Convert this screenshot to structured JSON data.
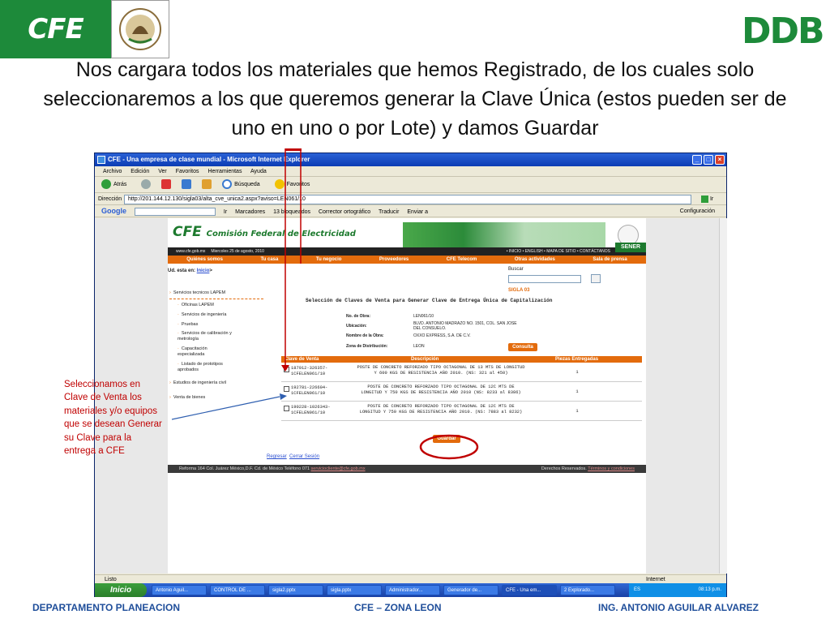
{
  "slide": {
    "title": "Nos cargara todos los materiales que hemos Registrado, de los cuales solo seleccionaremos a los que queremos generar la Clave Única (estos pueden ser de uno en uno o por Lote) y damos Guardar",
    "cfe_logo": "CFE",
    "ddb_logo": "DDB",
    "annotation": "Seleccionamos en Clave de Venta los materiales y/o equipos que se desean Generar su Clave para la entrega a CFE",
    "footer": {
      "left": "DEPARTAMENTO PLANEACION",
      "center": "CFE – ZONA LEON",
      "right": "ING. ANTONIO AGUILAR ALVAREZ"
    },
    "colors": {
      "accent_green": "#1d8a3a",
      "annotation_red": "#c00000",
      "footer_blue": "#1f4e9a"
    }
  },
  "browser": {
    "window_title": "CFE - Una empresa de clase mundial - Microsoft Internet Explorer",
    "menu": [
      "Archivo",
      "Edición",
      "Ver",
      "Favoritos",
      "Herramientas",
      "Ayuda"
    ],
    "toolbar": {
      "back": "Atrás",
      "search": "Búsqueda",
      "favorites": "Favoritos"
    },
    "address_label": "Dirección",
    "address": "http://201.144.12.130/sigla03/alta_cve_unica2.aspx?aviso=LEN061/10",
    "go": "Ir",
    "google": {
      "logo": "Google",
      "search_placeholder": "G",
      "go": "Ir",
      "bookmarks": "Marcadores",
      "blocked": "13 bloqueados",
      "spell": "Corrector ortográfico",
      "translate": "Traducir",
      "send": "Enviar a",
      "settings": "Configuración"
    },
    "status": "Listo",
    "zone": "Internet"
  },
  "taskbar": {
    "start": "Inicio",
    "tasks": [
      "Antonio Aguil...",
      "CONTROL DE ...",
      "sigla2.pptx",
      "sigla.pptx",
      "Administrador...",
      "Generador de...",
      "CFE - Una em...",
      "2 Explorado..."
    ],
    "lang": "ES",
    "clock": "08:13 p.m."
  },
  "site": {
    "logo": "CFE",
    "name": "Comisión Federal de Electricidad",
    "url": "www.cfe.gob.mx",
    "date": "Miercoles 25 de agosto, 2010",
    "top_links": "• INICIO • ENGLISH • MAPA DE SITIO • CONTÁCTANOS",
    "sener": "SENER",
    "nav": [
      "Quiénes somos",
      "Tu casa",
      "Tu negocio",
      "Proveedores",
      "CFE Telecom",
      "Otras actividades",
      "Sala de prensa"
    ],
    "breadcrumb_label": "Ud. esta en:",
    "breadcrumb_link": "Inicio",
    "search_label": "Buscar",
    "sidebar": {
      "section1": "Servicios tecnicos LAPEM",
      "items": [
        "Oficinas LAPEM",
        "Servicios de ingeniería",
        "Pruebas",
        "Servicios de calibración y metrología",
        "Capacitación especializada",
        "Listado de prototipos aprobados"
      ],
      "section2": "Estudios de ingeniería civil",
      "section3": "Venta de bienes"
    },
    "form": {
      "system": "SIGLA 03",
      "heading": "Selección de Claves de Venta para Generar Clave de Entrega Única de Capitalización",
      "obra_label": "No. de Obra:",
      "obra": "LEN061/10",
      "ubicacion_label": "Ubicación:",
      "ubicacion": "BLVD. ANTONIO MADRAZO NO. 1501, COL. SAN JOSE DEL CONSUELO.",
      "nombre_label": "Nombre de la Obra:",
      "nombre": "OXXO EXPRESS, S.A. DE C.V.",
      "zona_label": "Zona de Distribución:",
      "zona": "LEON",
      "consulta": "Consulta",
      "columns": [
        "Clave de Venta",
        "Descripción",
        "Piezas Entregadas"
      ],
      "rows": [
        {
          "clave": "187912-326357-1CFELEN061/10",
          "desc": "POSTE DE CONCRETO REFORZADO TIPO OCTAGONAL DE 13 MTS DE LONGITUD Y 600 KGS DE RESISTENCIA AÑO 2010. (NS: 321 al 450)",
          "qty": "1"
        },
        {
          "clave": "192781-226604-1CFELEN061/10",
          "desc": "POSTE DE CONCRETO REFORZADO TIPO OCTAGONAL DE 12C MTS DE LONGITUD Y 750 KGS DE RESISTENCIA AÑO 2010 (NS: 8233 al 8386)",
          "qty": "1"
        },
        {
          "clave": "190228-1026343-1CFELEN061/10",
          "desc": "POSTE DE CONCRETO REFORZADO TIPO OCTAGONAL DE 12C MTS DE LONGITUD Y 750 KGS DE RESISTENCIA AÑO 2010. (NS: 7883 al 8232)",
          "qty": "1"
        }
      ],
      "save": "Guardar",
      "back": "Regresar",
      "logout": "Cerrar Sesión"
    },
    "footer_left": "Reforma 164 Col. Juárez México,D.F.   Cd. de México Teléfono 071",
    "footer_email": "serviciocliente@cfe.gob.mx",
    "footer_right": "Derechos Reservados.",
    "footer_terms": "Términos y condiciones"
  }
}
